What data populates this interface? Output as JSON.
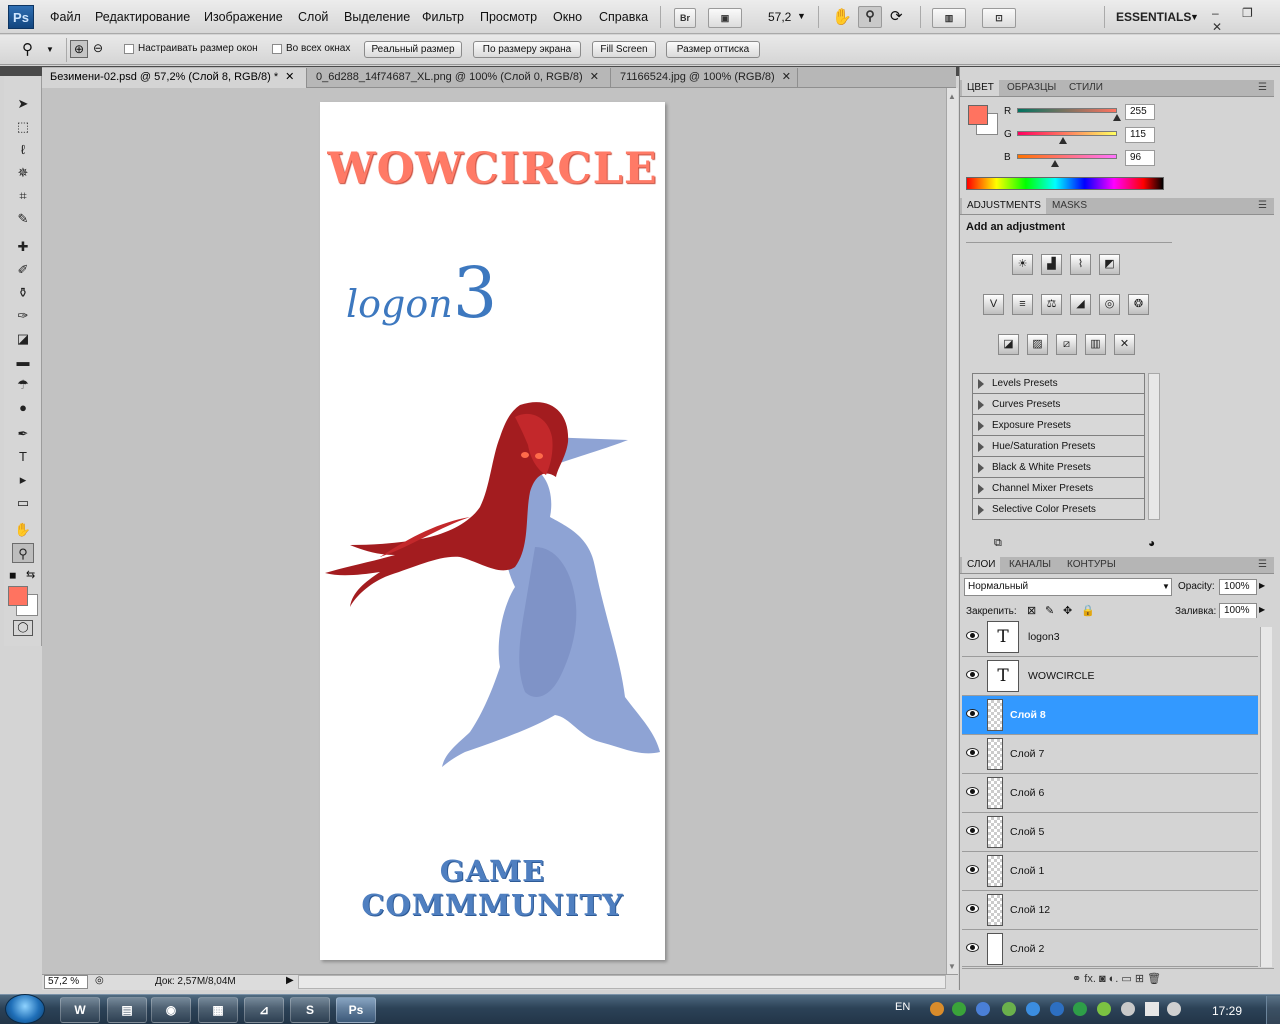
{
  "app": {
    "logo": "Ps",
    "zoom_display": "57,2",
    "workspace": "ESSENTIALS",
    "window_controls": "‒ ❐ ✕"
  },
  "menu": [
    "Файл",
    "Редактирование",
    "Изображение",
    "Слой",
    "Выделение",
    "Фильтр",
    "Просмотр",
    "Окно",
    "Справка"
  ],
  "menubar_buttons": {
    "bridge": "Br",
    "camera": "▣",
    "arrange": "▥",
    "screen": "⊡"
  },
  "options": {
    "resize_windows": "Настраивать размер окон",
    "all_windows": "Во всех окнах",
    "actual_pixels": "Реальный размер",
    "fit_screen": "По размеру экрана",
    "fill_screen": "Fill Screen",
    "print_size": "Размер оттиска"
  },
  "tabs": [
    {
      "title": "Безимени-02.psd @ 57,2% (Слой 8, RGB/8) *",
      "close": "✕"
    },
    {
      "title": "0_6d288_14f74687_XL.png @ 100% (Слой 0, RGB/8)",
      "close": "✕"
    },
    {
      "title": "71166524.jpg @ 100% (RGB/8)",
      "close": "✕"
    }
  ],
  "document": {
    "title_text": "WOWCIRCLE",
    "logo_text": "logon",
    "logo_number": "3",
    "bottom_text": "GAME COMMMUNITY"
  },
  "status": {
    "zoom": "57,2 %",
    "doc_size": "Док: 2,57M/8,04M"
  },
  "color_panel": {
    "tabs": [
      "ЦВЕТ",
      "ОБРАЗЦЫ",
      "СТИЛИ"
    ],
    "channels": [
      {
        "label": "R",
        "value": "255"
      },
      {
        "label": "G",
        "value": "115"
      },
      {
        "label": "B",
        "value": "96"
      }
    ],
    "foreground": "#ff7360",
    "background": "#ffffff"
  },
  "adjustments": {
    "tabs": [
      "ADJUSTMENTS",
      "MASKS"
    ],
    "heading": "Add an adjustment",
    "presets": [
      "Levels Presets",
      "Curves Presets",
      "Exposure Presets",
      "Hue/Saturation Presets",
      "Black & White Presets",
      "Channel Mixer Presets",
      "Selective Color Presets"
    ]
  },
  "layers_panel": {
    "tabs": [
      "СЛОИ",
      "КАНАЛЫ",
      "КОНТУРЫ"
    ],
    "blend_mode": "Нормальный",
    "opacity_label": "Opacity:",
    "opacity": "100%",
    "lock_label": "Закрепить:",
    "fill_label": "Заливка:",
    "fill": "100%",
    "layers": [
      {
        "name": "logon3",
        "type": "text",
        "selected": false
      },
      {
        "name": "WOWCIRCLE",
        "type": "text",
        "selected": false
      },
      {
        "name": "Слой 8",
        "type": "pixel",
        "selected": true
      },
      {
        "name": "Слой 7",
        "type": "pixel",
        "selected": false
      },
      {
        "name": "Слой 6",
        "type": "pixel",
        "selected": false
      },
      {
        "name": "Слой 5",
        "type": "pixel",
        "selected": false
      },
      {
        "name": "Слой 1",
        "type": "pixel",
        "selected": false
      },
      {
        "name": "Слой 12",
        "type": "pixel",
        "selected": false
      },
      {
        "name": "Слой 2",
        "type": "pixel",
        "selected": false
      }
    ],
    "footer_icons": "⚭   fx.   ◙   ◐.   ▭   ⊞   🗑"
  },
  "taskbar": {
    "lang": "EN",
    "time": "17:29",
    "buttons": [
      "W",
      "▤",
      "◉",
      "▦",
      "⊿",
      "S",
      "Ps"
    ]
  }
}
